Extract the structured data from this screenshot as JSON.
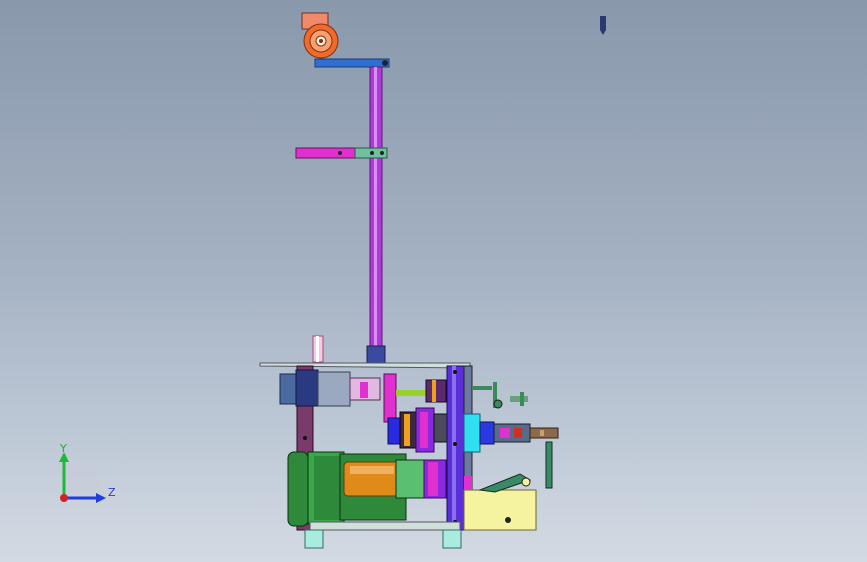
{
  "viewport": {
    "description_colors": {
      "background_top": "#8a98ac",
      "background_bottom": "#d3dae3"
    }
  },
  "triad": {
    "y_label": "Y",
    "z_label": "Z",
    "colors": {
      "y_axis": "#1fb83a",
      "z_axis": "#1f3ee0",
      "x_axis": "#d42020"
    }
  },
  "model": {
    "colors": {
      "pulley": "#f06a2a",
      "pulley_bracket": "#f08a6a",
      "top_arm": "#2f6fd0",
      "mast": "#b03ad8",
      "mid_arm": "#e030d0",
      "mid_arm_clamp": "#6fc0a0",
      "frame_side": "#7a3a6a",
      "frame_upright": "#5a2fd8",
      "motor_body": "#2e8a3a",
      "motor_can": "#e08a1a",
      "coupling": "#8a2ae0",
      "base_plate": "#f5f3a0",
      "feet": "#a8ece0",
      "shaft": "#9ad02a",
      "cyan_drum": "#30e0f0"
    }
  },
  "icons": {
    "top_right_marker": "pen-marker-icon"
  }
}
